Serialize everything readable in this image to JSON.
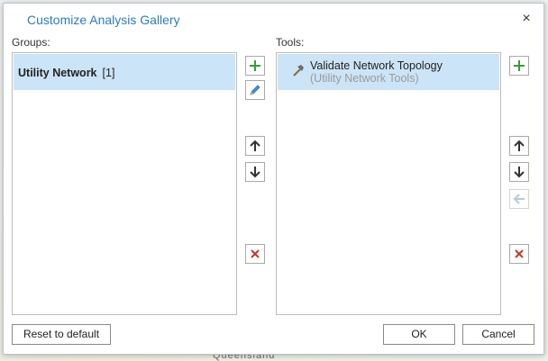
{
  "background": {
    "label": "Queensland"
  },
  "dialog": {
    "title": "Customize Analysis Gallery",
    "close_glyph": "×"
  },
  "groups": {
    "label": "Groups:",
    "items": [
      {
        "name": "Utility Network",
        "count": "[1]",
        "selected": true
      }
    ]
  },
  "tools": {
    "label": "Tools:",
    "items": [
      {
        "name": "Validate Network Topology",
        "toolbox": "(Utility Network Tools)",
        "icon": "hammer-icon",
        "selected": true
      }
    ]
  },
  "side_buttons": {
    "groups": [
      "add-icon",
      "edit-pencil-icon",
      "arrow-up-icon",
      "arrow-down-icon",
      "delete-x-icon"
    ],
    "tools": [
      "add-icon",
      "arrow-up-icon",
      "arrow-down-icon",
      "arrow-left-icon",
      "delete-x-icon"
    ]
  },
  "footer": {
    "reset_label": "Reset to default",
    "ok_label": "OK",
    "cancel_label": "Cancel"
  },
  "colors": {
    "title": "#2b7bc0",
    "selection": "#cce4f7",
    "add_green": "#3a9a3a",
    "delete_red": "#c0392b",
    "arrow": "#333333"
  }
}
